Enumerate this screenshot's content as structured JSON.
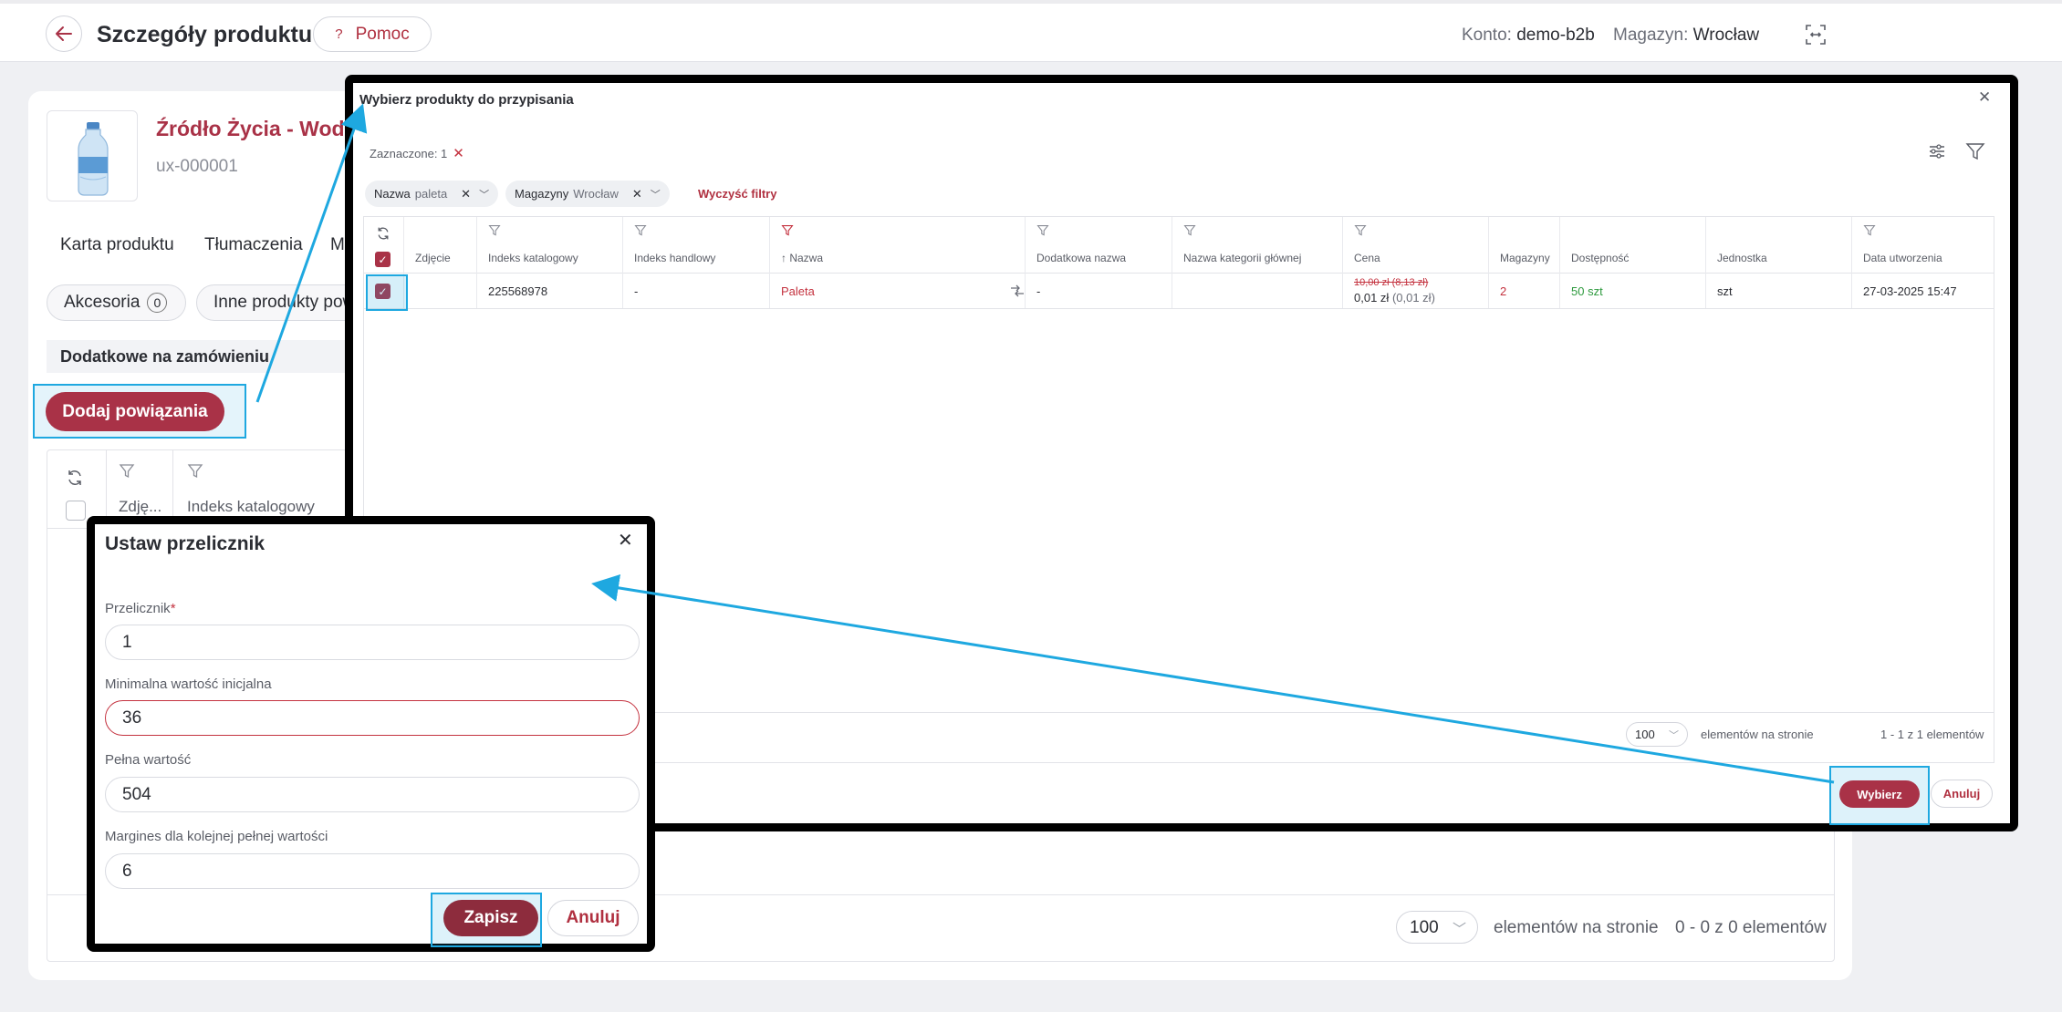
{
  "header": {
    "title": "Szczegóły produktu",
    "help_label": "Pomoc",
    "account_label": "Konto:",
    "account_value": "demo-b2b",
    "warehouse_label": "Magazyn:",
    "warehouse_value": "Wrocław"
  },
  "product": {
    "name": "Źródło Życia - Woda n",
    "code": "ux-000001"
  },
  "tabs": [
    "Karta produktu",
    "Tłumaczenia",
    "M"
  ],
  "chips": {
    "accessories_label": "Akcesoria",
    "accessories_count": "0",
    "other_label": "Inne produkty pow"
  },
  "section": {
    "title": "Dodatkowe na zamówieniu",
    "add_button": "Dodaj powiązania"
  },
  "bg_table": {
    "columns": [
      "Zdję...",
      "Indeks katalogowy"
    ],
    "page_size": "100",
    "per_page_label": "elementów na stronie",
    "range_label": "0 - 0 z 0 elementów"
  },
  "select_modal": {
    "title": "Wybierz produkty do przypisania",
    "marked_label": "Zaznaczone: 1",
    "filters": [
      {
        "name": "Nazwa",
        "value": "paleta"
      },
      {
        "name": "Magazyny",
        "value": "Wrocław"
      }
    ],
    "clear_filters": "Wyczyść filtry",
    "columns": [
      "Zdjęcie",
      "Indeks katalogowy",
      "Indeks handlowy",
      "Nazwa",
      "Dodatkowa nazwa",
      "Nazwa kategorii głównej",
      "Cena",
      "Magazyny",
      "Dostępność",
      "Jednostka",
      "Data utworzenia"
    ],
    "sort_arrow": "↑",
    "row": {
      "catalog_index": "225568978",
      "trade_index": "-",
      "name": "Paleta",
      "extra_name": "-",
      "price_old": "10,00 zł (8,13 zł)",
      "price_new": "0,01 zł",
      "price_net": "(0,01 zł)",
      "warehouses": "2",
      "availability": "50 szt",
      "unit": "szt",
      "created": "27-03-2025 15:47"
    },
    "page_size": "100",
    "per_page_label": "elementów na stronie",
    "range_label": "1 - 1 z 1 elementów",
    "select_button": "Wybierz",
    "cancel_button": "Anuluj"
  },
  "converter_modal": {
    "title": "Ustaw przelicznik",
    "fields": [
      {
        "label": "Przelicznik",
        "required": "*",
        "value": "1"
      },
      {
        "label": "Minimalna wartość inicjalna",
        "value": "36"
      },
      {
        "label": "Pełna wartość",
        "value": "504"
      },
      {
        "label": "Margines dla kolejnej pełnej wartości",
        "value": "6"
      }
    ],
    "save_button": "Zapisz",
    "cancel_button": "Anuluj"
  },
  "colors": {
    "brand": "#a93247",
    "highlight": "#1ea8e0",
    "available": "#2e9a3e"
  }
}
